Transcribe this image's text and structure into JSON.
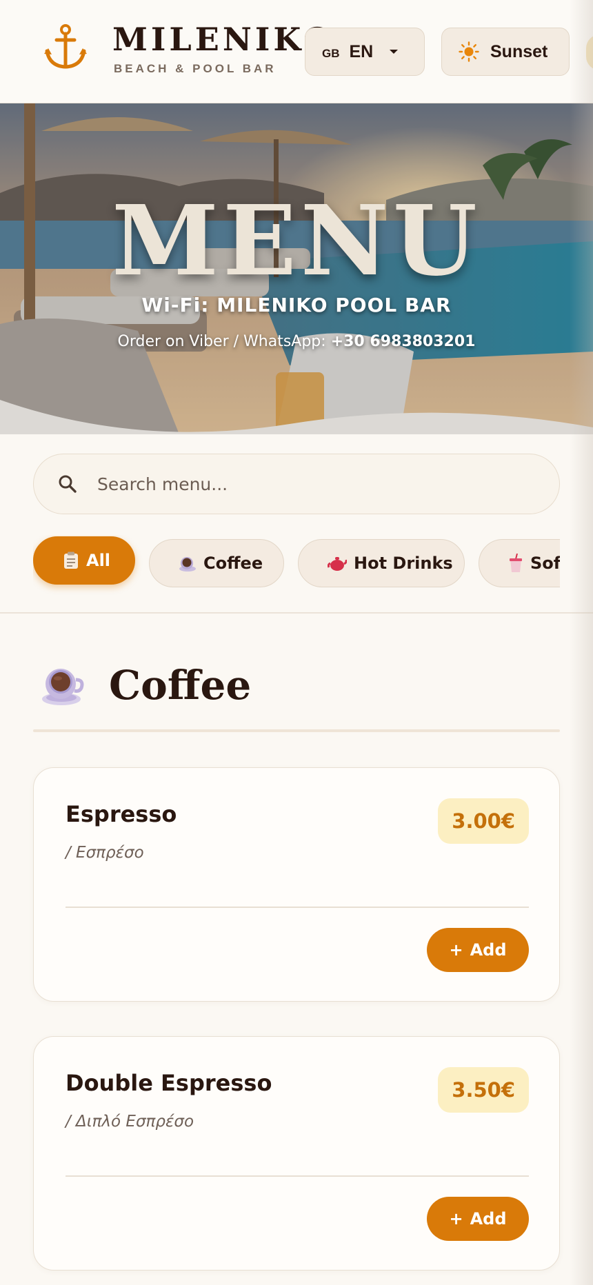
{
  "header": {
    "brand_title": "MILENIKO",
    "brand_subtitle": "BEACH & POOL BAR",
    "language": {
      "flag": "GB",
      "code": "EN"
    },
    "theme_label": "Sunset"
  },
  "hero": {
    "title": "MENU",
    "wifi": "Wi-Fi: MILENIKO POOL BAR",
    "order_prefix": "Order on Viber / WhatsApp: ",
    "order_phone": "+30 6983803201"
  },
  "search": {
    "placeholder": "Search menu..."
  },
  "categories": [
    {
      "label": "All",
      "icon": "menu-clipboard-icon",
      "active": true
    },
    {
      "label": "Coffee",
      "icon": "coffee-cup-icon",
      "active": false
    },
    {
      "label": "Hot Drinks",
      "icon": "teapot-icon",
      "active": false
    },
    {
      "label": "Sof",
      "icon": "soft-drink-cup-icon",
      "active": false
    }
  ],
  "section": {
    "title": "Coffee",
    "icon": "coffee-cup-icon"
  },
  "items": [
    {
      "name": "Espresso",
      "alt_name": "/ Εσπρέσο",
      "price": "3.00€",
      "add_label": "Add"
    },
    {
      "name": "Double Espresso",
      "alt_name": "/ Διπλό Εσπρέσο",
      "price": "3.50€",
      "add_label": "Add"
    }
  ],
  "colors": {
    "accent": "#d97a09",
    "price_bg": "#fcefc2",
    "price_text": "#c4700a",
    "text_dark": "#2a1710",
    "page_bg": "#fbf8f3"
  }
}
